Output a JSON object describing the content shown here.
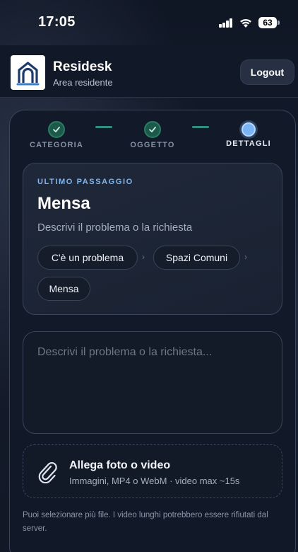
{
  "status_bar": {
    "time": "17:05",
    "battery": "63",
    "icons": [
      "signal-icon",
      "wifi-icon",
      "battery-icon"
    ]
  },
  "header": {
    "app_name": "Residesk",
    "subtitle": "Area residente",
    "logout_label": "Logout",
    "logo_icon": "residesk-logo"
  },
  "stepper": {
    "steps": [
      {
        "label": "CATEGORIA",
        "state": "done"
      },
      {
        "label": "OGGETTO",
        "state": "done"
      },
      {
        "label": "DETTAGLI",
        "state": "current"
      }
    ]
  },
  "summary": {
    "eyebrow": "ULTIMO PASSAGGIO",
    "title": "Mensa",
    "subtitle": "Descrivi il problema o la richiesta",
    "breadcrumb": [
      "C'è un problema",
      "Spazi Comuni",
      "Mensa"
    ],
    "separator": "›"
  },
  "form": {
    "description_placeholder": "Descrivi il problema o la richiesta...",
    "description_value": ""
  },
  "attachments": {
    "title": "Allega foto o video",
    "subtitle": "Immagini, MP4 o WebM · video max ~15s",
    "icon": "paperclip-icon"
  },
  "note": "Puoi selezionare più file. I video lunghi potrebbero essere rifiutati dal server.",
  "colors": {
    "accent": "#7fb6f2",
    "step_done": "#1b5a4a",
    "connector": "#2f8e7d",
    "background": "#111827"
  }
}
